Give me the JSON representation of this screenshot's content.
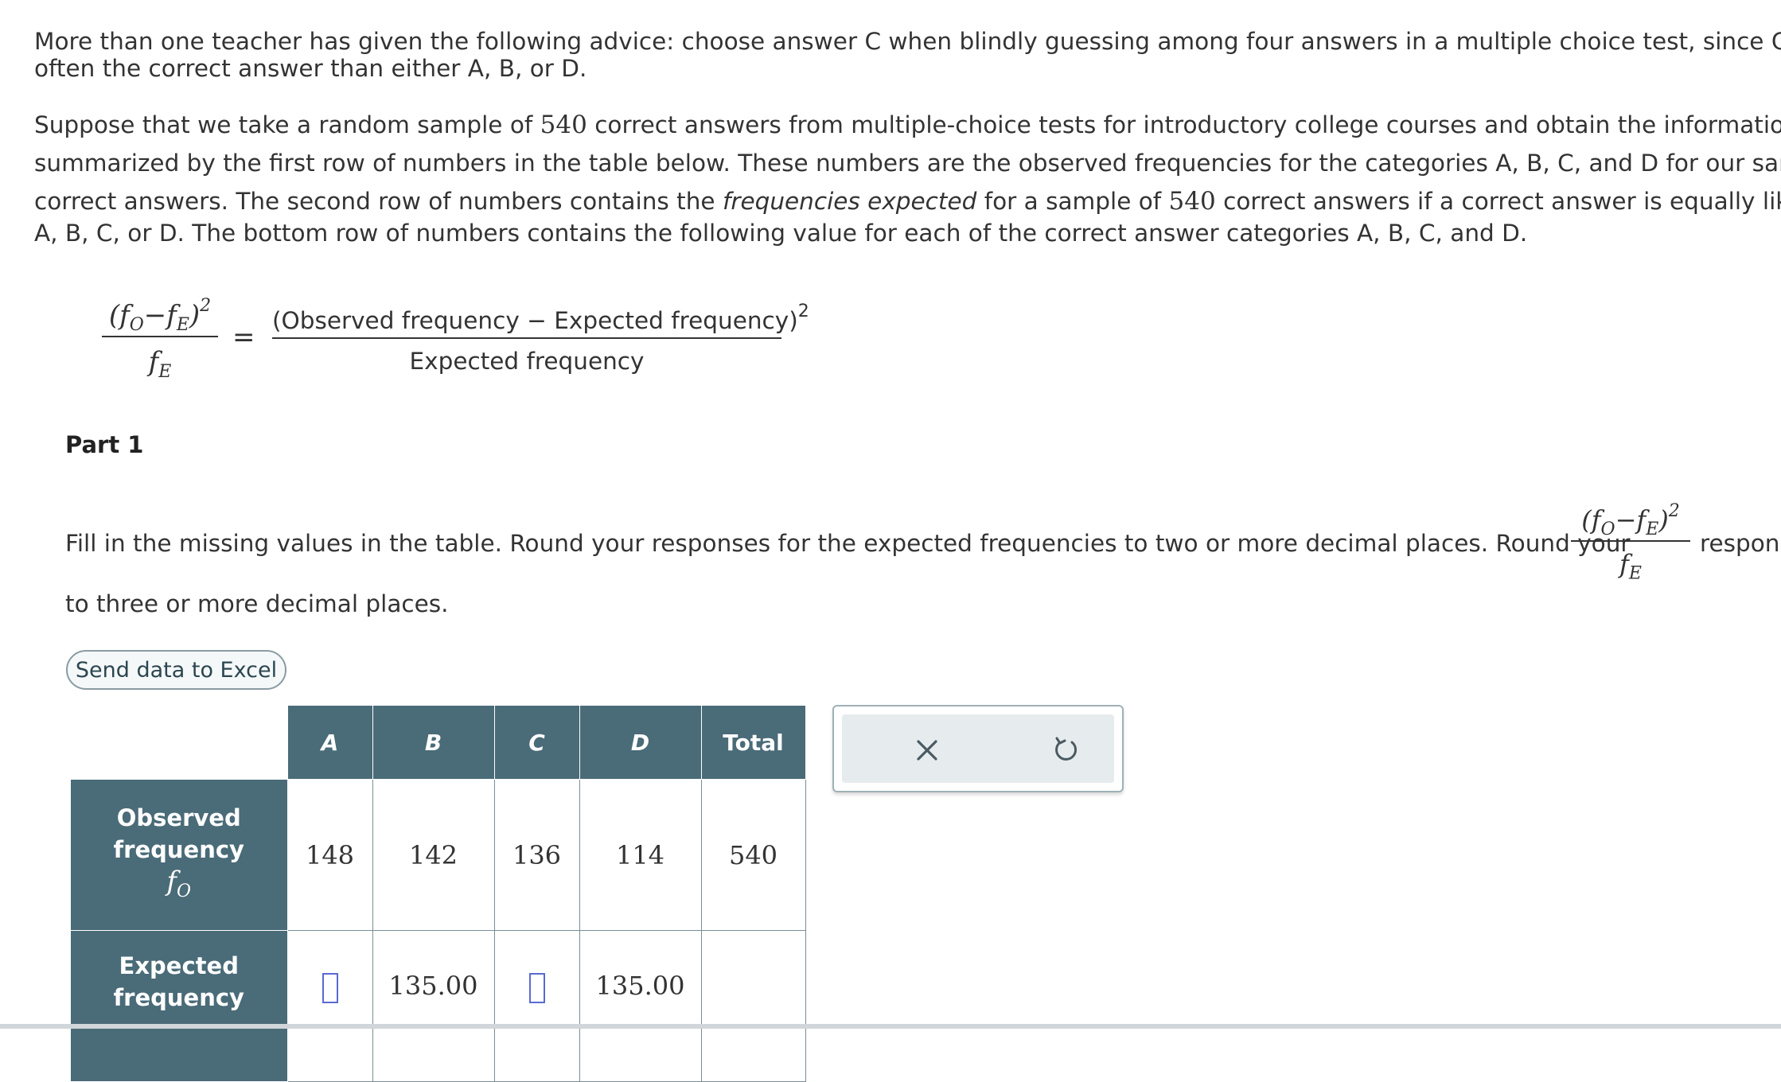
{
  "intro": {
    "line1": "More than one teacher has given the following advice: choose answer C when blindly guessing among four answers in a multiple choice test, since C is mor",
    "line2": "often the correct answer than either A, B, or D."
  },
  "setup": {
    "l1_pre": "Suppose that we take a random sample of ",
    "sample_size": "540",
    "l1_post": " correct answers from multiple-choice tests for introductory college courses and obtain the information",
    "l2": "summarized by the first row of numbers in the table below. These numbers are the observed frequencies for the categories A, B, C, and D for our sample o",
    "l3_pre": "correct answers. The second row of numbers contains the ",
    "l3_em": "frequencies expected",
    "l3_mid": " for a sample of ",
    "l3_post": " correct answers if a correct answer is equally likely to b",
    "l4": "A, B, C, or D. The bottom row of numbers contains the following value for each of the correct answer categories A, B, C, and D."
  },
  "formula": {
    "left_num": "(f",
    "sub_o": "O",
    "minus": "−f",
    "sub_e": "E",
    "close": ")",
    "exp": "2",
    "left_den": "f",
    "equals": "=",
    "right_num": "(Observed frequency − Expected frequency)",
    "right_den": "Expected frequency"
  },
  "part": {
    "title": "Part 1",
    "instr_pre": "Fill in the missing values in the table. Round your responses for the expected frequencies to two or more decimal places. Round your",
    "instr_post": "respons",
    "instr_line2": "to three or more decimal places."
  },
  "excel_button": "Send data to Excel",
  "table": {
    "columns": [
      "A",
      "B",
      "C",
      "D",
      "Total"
    ],
    "rows": [
      {
        "label1": "Observed",
        "label2": "frequency",
        "symbol": "f",
        "symbol_sub": "O",
        "values": [
          "148",
          "142",
          "136",
          "114",
          "540"
        ]
      },
      {
        "label1": "Expected",
        "label2": "frequency",
        "values": [
          "",
          "135.00",
          "",
          "135.00",
          ""
        ]
      }
    ]
  },
  "icons": {
    "clear": "close-icon",
    "reset": "undo-icon"
  }
}
